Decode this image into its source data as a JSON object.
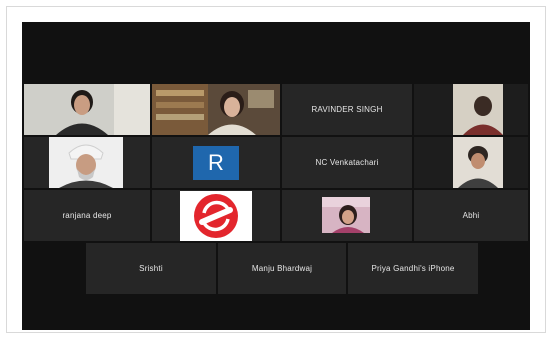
{
  "participants": {
    "ravinder": "RAVINDER SINGH",
    "nc": "NC Venkatachari",
    "ranjana": "ranjana deep",
    "abhi": "Abhi",
    "srishti": "Srishti",
    "manju": "Manju Bhardwaj",
    "priya": "Priya Gandhi's iPhone",
    "r_initial": "R"
  },
  "colors": {
    "screen_bg": "#111111",
    "tile_bg": "#262626",
    "active_speaker_border": "#8bc34a",
    "r_logo_bg": "#1f67ad",
    "brand_logo_red": "#e3262d"
  }
}
